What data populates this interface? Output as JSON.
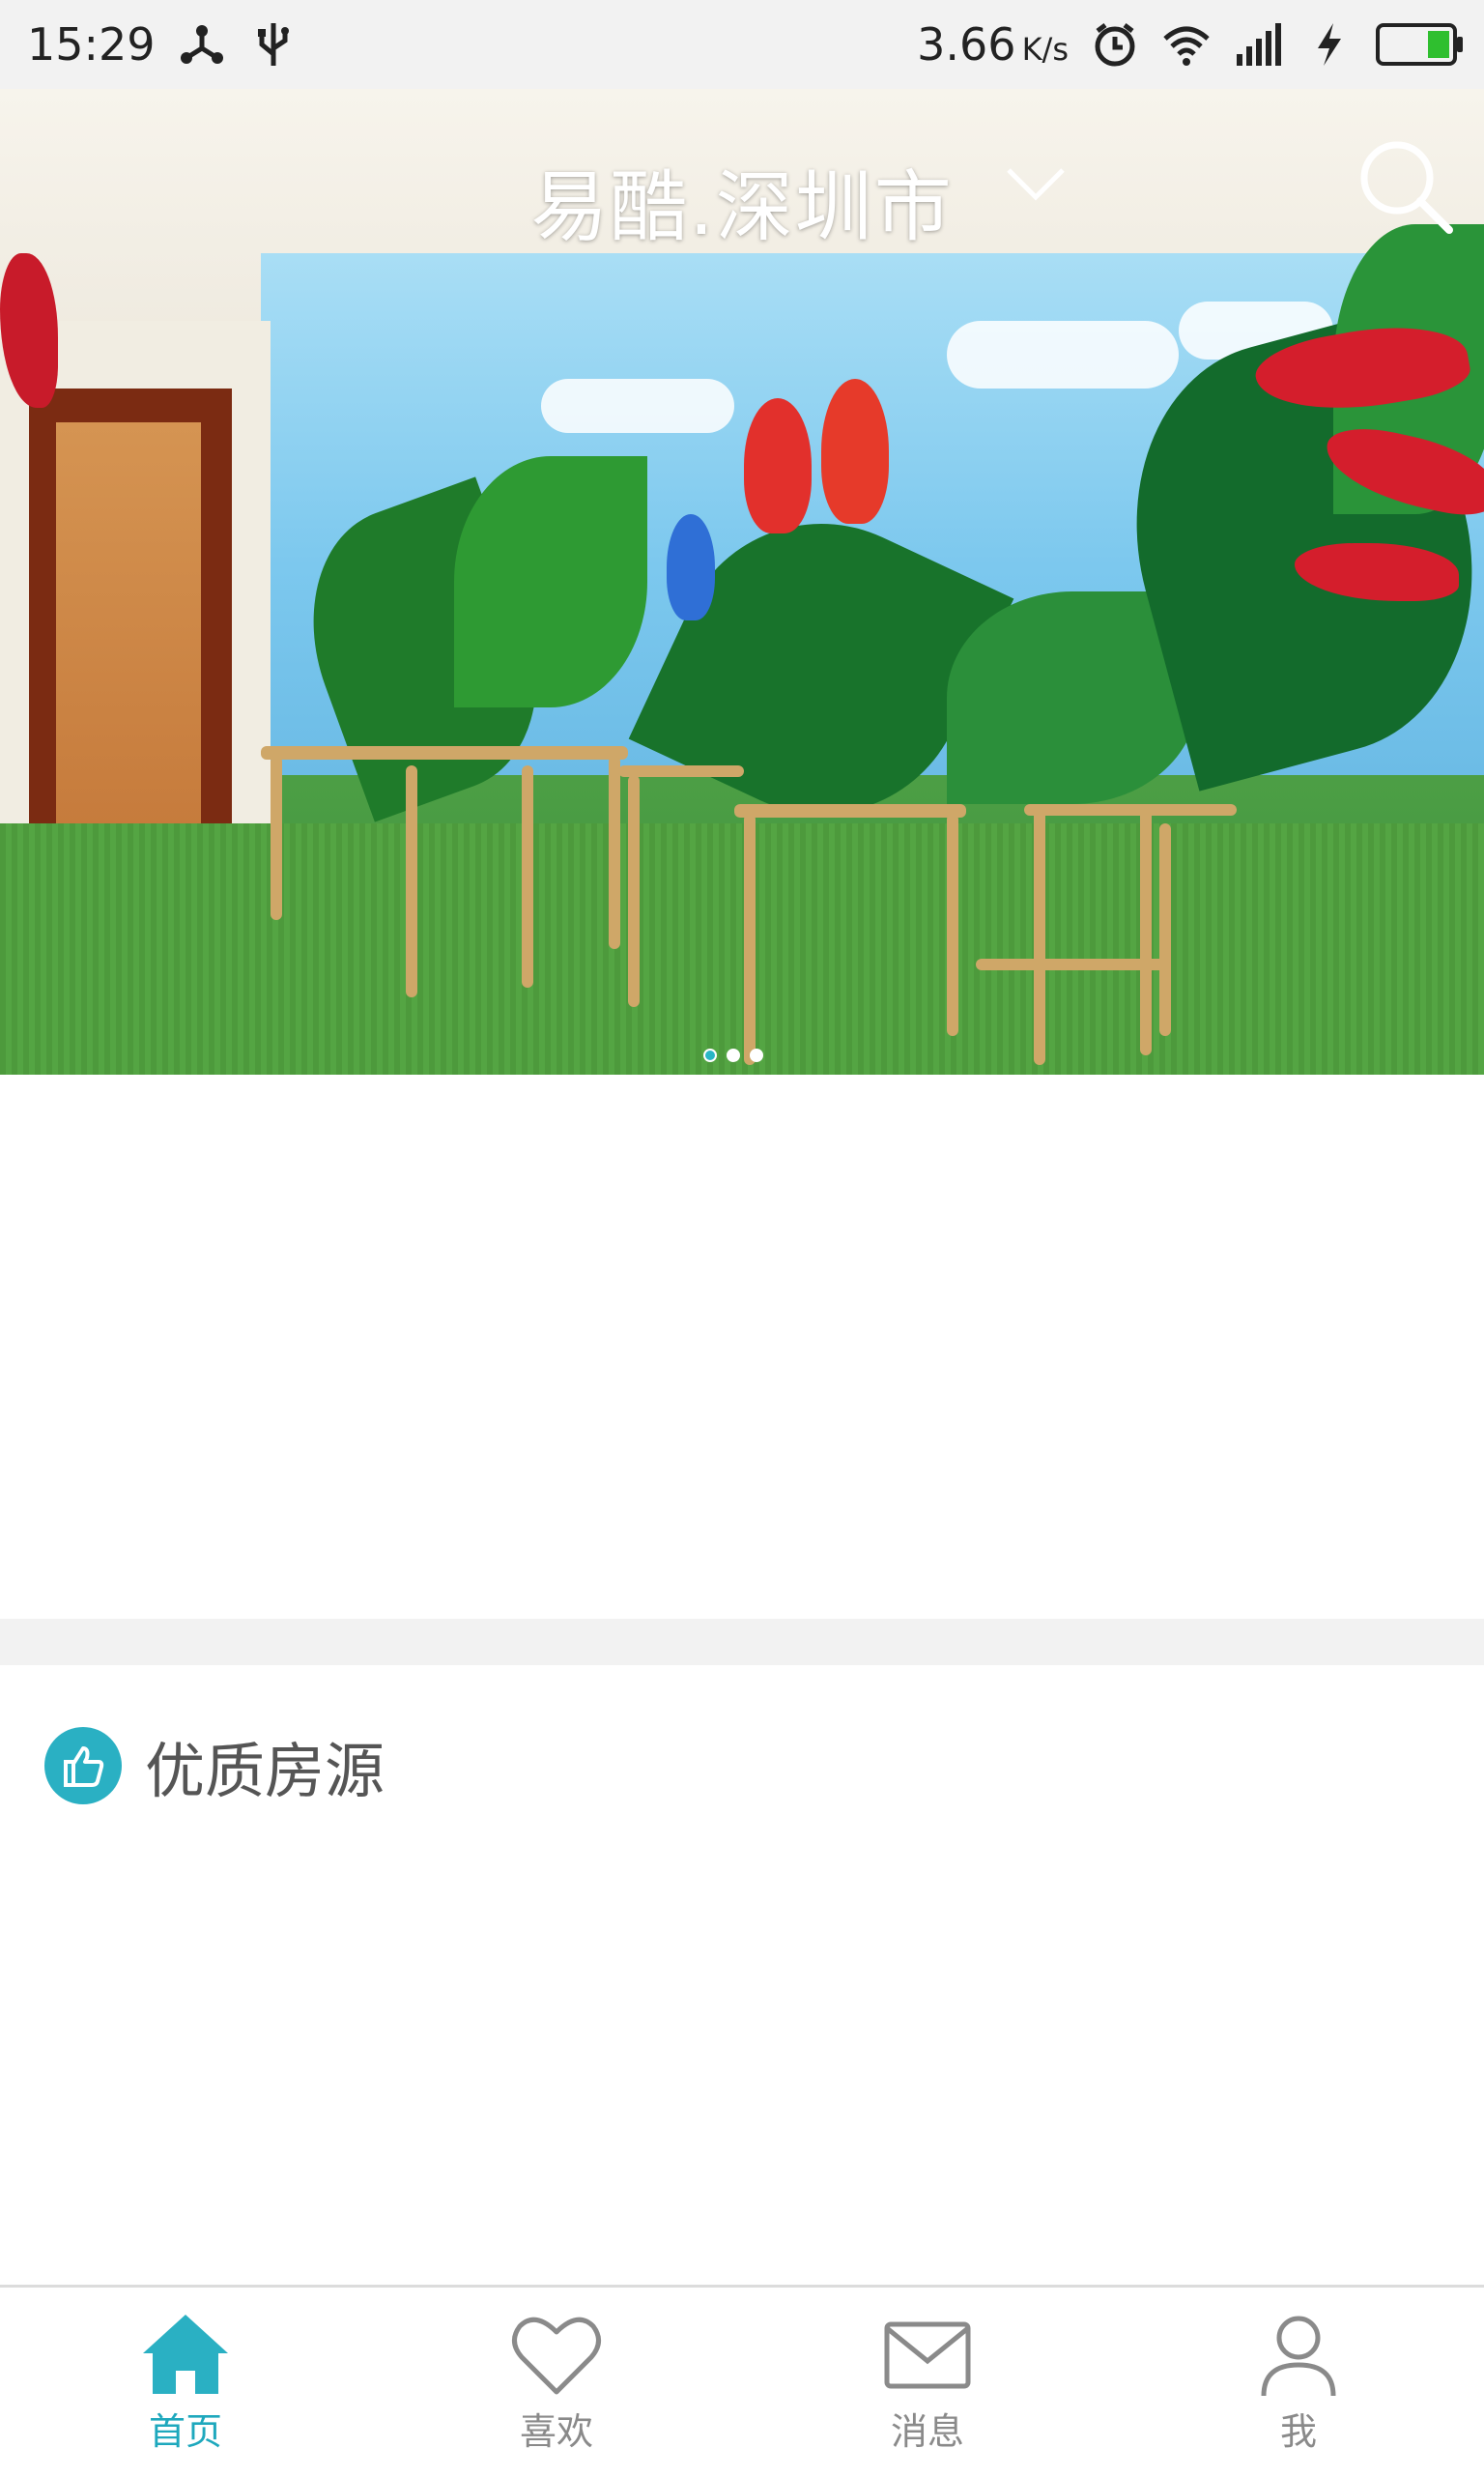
{
  "status_bar": {
    "time": "15:29",
    "speed_value": "3.66",
    "speed_unit": "K/s",
    "icons": [
      "share-icon",
      "usb-icon",
      "alarm-icon",
      "wifi-icon",
      "signal-3g-icon",
      "charging-icon",
      "battery-icon"
    ]
  },
  "header": {
    "title": "易酷.深圳市"
  },
  "banner": {
    "page_count": 3,
    "active_index": 0
  },
  "section": {
    "title": "优质房源"
  },
  "bottom_nav": {
    "items": [
      {
        "label": "首页",
        "icon": "home-icon",
        "active": true
      },
      {
        "label": "喜欢",
        "icon": "heart-icon",
        "active": false
      },
      {
        "label": "消息",
        "icon": "mail-icon",
        "active": false
      },
      {
        "label": "我",
        "icon": "profile-icon",
        "active": false
      }
    ]
  },
  "colors": {
    "accent": "#2ab0c3",
    "inactive": "#8a8a8a",
    "separator": "#f2f2f2"
  }
}
